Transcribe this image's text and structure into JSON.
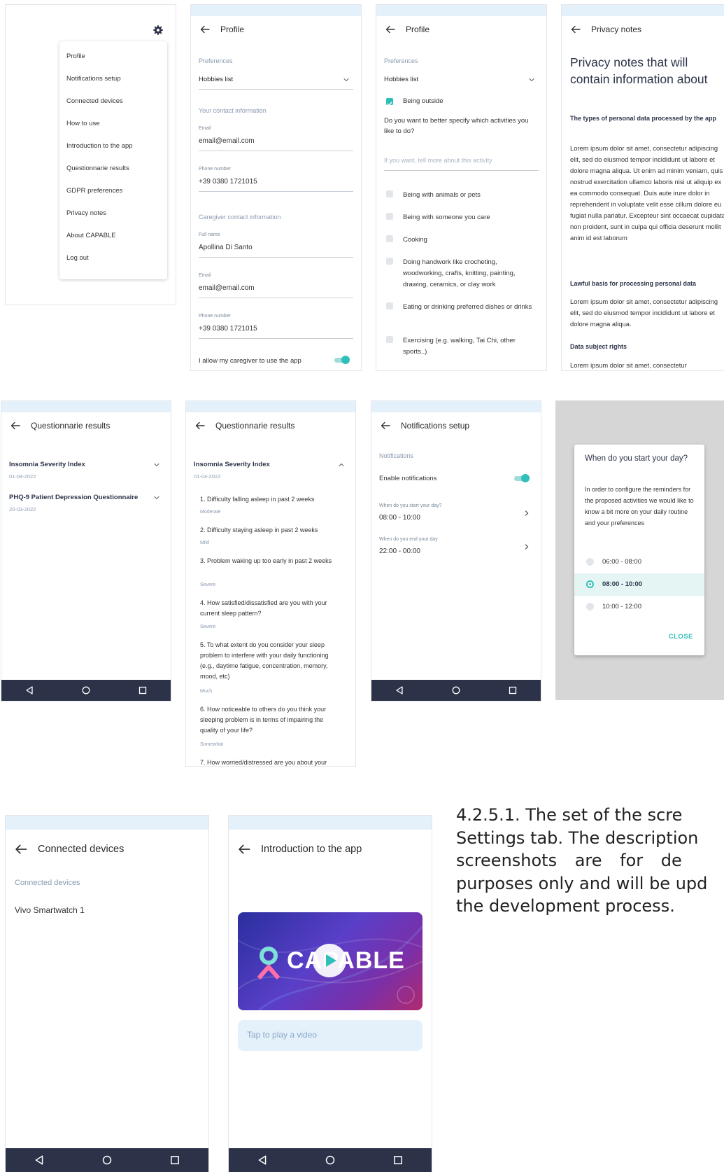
{
  "menu": {
    "items": [
      "Profile",
      "Notifications setup",
      "Connected devices",
      "How to use",
      "Introduction to the app",
      "Questionnarie results",
      "GDPR preferences",
      "Privacy notes",
      "About CAPABLE",
      "Log out"
    ]
  },
  "profile1": {
    "title": "Profile",
    "preferences_label": "Preferences",
    "hobbies_label": "Hobbies list",
    "contact_section": "Your contact information",
    "email_label": "Email",
    "email_value": "email@email.com",
    "phone_label": "Phone number",
    "phone_value": "+39 0380 1721015",
    "caregiver_section": "Caregiver contact information",
    "fullname_label": "Full name",
    "fullname_value": "Apollina Di Santo",
    "cg_email_label": "Email",
    "cg_email_value": "email@email.com",
    "cg_phone_label": "Phone number",
    "cg_phone_value": "+39 0380 1721015",
    "allow_label": "I allow my caregiver to use the app",
    "allow_on": true
  },
  "profile2": {
    "title": "Profile",
    "preferences_label": "Preferences",
    "hobbies_label": "Hobbies list",
    "being_outside": "Being outside",
    "specify_question": "Do you want to better specify which activities you like to do?",
    "tell_more_placeholder": "If you want, tell more about this activity",
    "activities": [
      "Being with animals or pets",
      "Being with someone you care",
      "Cooking",
      "Doing handwork like crocheting, woodworking, crafts, knitting, painting, drawing, ceramics, or clay work",
      "Eating or drinking preferred dishes or drinks",
      "Exercising (e.g. walking, Tai Chi, other sports..)"
    ]
  },
  "privacy": {
    "title": "Privacy notes",
    "heading": "Privacy notes that will contain information about",
    "s1_title": "The types of personal data processed by the app",
    "s1_body": "Lorem ipsum dolor sit amet, consectetur adipiscing elit, sed do eiusmod tempor incididunt ut labore et dolore magna aliqua. Ut enim ad minim veniam, quis nostrud exercitation ullamco laboris nisi ut aliquip ex ea commodo consequat. Duis aute irure dolor in reprehenderit in voluptate velit esse cillum dolore eu fugiat nulla pariatur. Excepteur sint occaecat cupidatat non proident, sunt in culpa qui officia deserunt mollit anim id est laborum",
    "s2_title": "Lawful basis for processing personal data",
    "s2_body": "Lorem ipsum dolor sit amet, consectetur adipiscing elit, sed do eiusmod tempor incididunt ut labore et dolore magna aliqua.",
    "s3_title": "Data subject rights",
    "s3_body": "Lorem ipsum dolor sit amet, consectetur"
  },
  "qres1": {
    "title": "Questionnarie results",
    "q1_name": "Insomnia Severity Index",
    "q1_date": "01-04-2022",
    "q2_name": "PHQ-9 Patient Depression Questionnaire",
    "q2_date": "20-03-2022"
  },
  "qres2": {
    "title": "Questionnarie results",
    "q_name": "Insomnia Severity Index",
    "q_date": "01-04-2022",
    "items": [
      {
        "q": "1. Difficulty falling asleep in past 2 weeks",
        "a": "Moderate"
      },
      {
        "q": "2. Difficulty staying asleep in past 2 weeks",
        "a": "Mild"
      },
      {
        "q": "3. Problem waking up too early in past 2 weeks",
        "a": "Severe"
      },
      {
        "q": "4. How satisfied/dissatisfied are you with your current sleep pattern?",
        "a": "Severe"
      },
      {
        "q": "5. To what extent do you consider your sleep problem to interfere with your daily functioning (e.g., daytime fatigue, concentration, memory, mood, etc)",
        "a": "Much"
      },
      {
        "q": "6. How noticeable to others do you think your sleeping problem is in terms of impairing the quality of your life?",
        "a": "Somewhat"
      },
      {
        "q": "7. How worried/distressed are you about your",
        "a": ""
      }
    ]
  },
  "notif": {
    "title": "Notifications setup",
    "section": "Notifications",
    "enable_label": "Enable notifications",
    "enable_on": true,
    "start_label": "When do you start your day?",
    "start_value": "08:00 - 10:00",
    "end_label": "When do you end your day",
    "end_value": "22:00 - 00:00"
  },
  "dialog": {
    "title": "When do you start your day?",
    "body": "In order to configure the reminders for the proposed activities we would like to know a bit more on your daily routine and your preferences",
    "options": [
      "06:00 - 08:00",
      "08:00 - 10:00",
      "10:00 - 12:00"
    ],
    "selected": 1,
    "close_label": "CLOSE"
  },
  "devices": {
    "title": "Connected devices",
    "section": "Connected devices",
    "device": "Vivo Smartwatch 1"
  },
  "intro": {
    "title": "Introduction to the app",
    "video_brand": "CAPABLE",
    "tap_label": "Tap to play a video"
  },
  "caption": {
    "line1": "4.2.5.1. The set of the scre",
    "line2": "Settings tab. The description",
    "line3": "screenshots are for de",
    "line4": "purposes only and will be upd",
    "line5": "the development process."
  },
  "colors": {
    "accent": "#2fbfb9",
    "navbar": "#2c3349",
    "band": "#e4f1fb"
  }
}
